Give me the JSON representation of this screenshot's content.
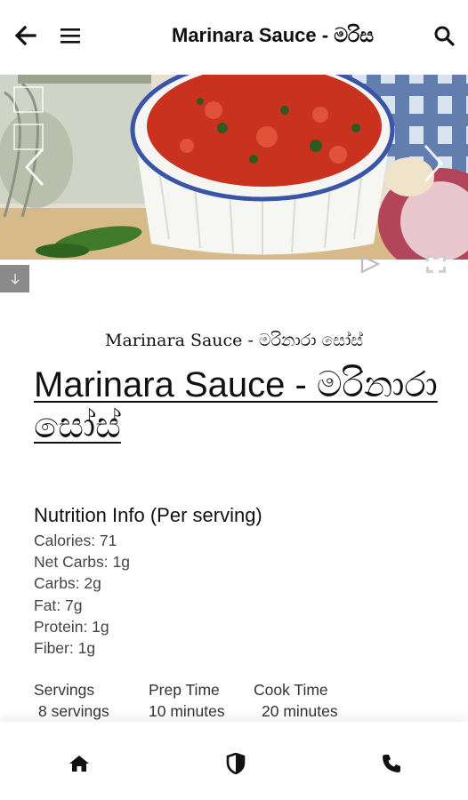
{
  "header": {
    "title": "Marinara Sauce - මරිස",
    "icons": [
      "back-arrow-icon",
      "hamburger-menu-icon",
      "search-icon"
    ]
  },
  "hero": {
    "icons": [
      "prev-chevron-icon",
      "next-chevron-icon",
      "download-arrow-icon",
      "play-icon",
      "fullscreen-icon"
    ]
  },
  "article": {
    "subtitle": "Marinara Sauce - මරිනාරා සෝස්",
    "title": "Marinara Sauce - මරිනාරා සෝස්",
    "nutrition": {
      "heading": "Nutrition Info (Per serving)",
      "items": [
        "Calories: 71",
        "Net Carbs: 1g",
        "Carbs: 2g",
        "Fat: 7g",
        "Protein: 1g",
        "Fiber: 1g"
      ]
    },
    "stats": [
      {
        "label": "Servings",
        "value": "8 servings"
      },
      {
        "label": "Prep Time",
        "value": "10 minutes"
      },
      {
        "label": "Cook Time",
        "value": "20 minutes"
      }
    ]
  },
  "bottom_nav": {
    "items": [
      "home-icon",
      "shield-icon",
      "phone-icon"
    ]
  },
  "colors": {
    "sauce": "#c8321e",
    "bowl_rim": "#3a55a8",
    "download_bg": "#8a8a8a"
  }
}
